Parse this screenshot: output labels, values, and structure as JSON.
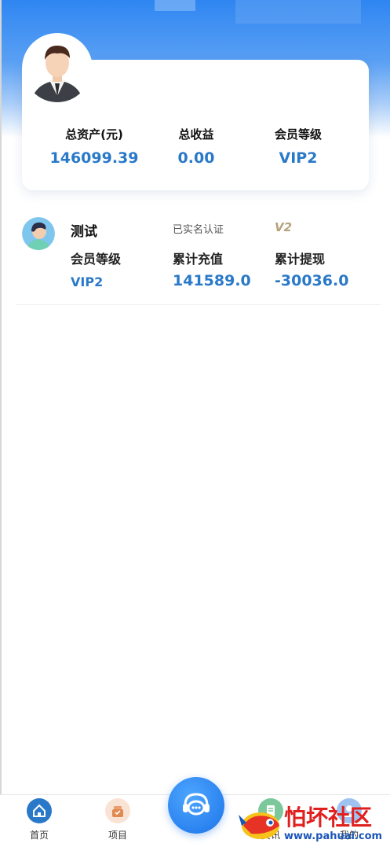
{
  "profile": {
    "avatar_icon": "male-avatar-icon",
    "stats": [
      {
        "label": "总资产(元)",
        "value": "146099.39"
      },
      {
        "label": "总收益",
        "value": "0.00"
      },
      {
        "label": "会员等级",
        "value": "VIP2"
      }
    ]
  },
  "user": {
    "avatar_icon": "user-avatar-icon",
    "name": "测试",
    "verified": "已实名认证",
    "vip_badge": "V2",
    "level_label": "会员等级",
    "level_value": "VIP2",
    "recharge_label": "累计充值",
    "recharge_value": "141589.0",
    "withdraw_label": "累计提现",
    "withdraw_value": "-30036.0"
  },
  "tabbar": {
    "items": [
      {
        "label": "首页",
        "icon": "home-icon"
      },
      {
        "label": "项目",
        "icon": "gift-icon"
      },
      {
        "label": "资讯",
        "icon": "news-icon"
      },
      {
        "label": "我的",
        "icon": "user-icon"
      }
    ],
    "service_icon": "customer-service-icon"
  },
  "watermark": {
    "title": "怕坏社区",
    "url": "www.pahuai.com"
  },
  "colors": {
    "accent": "#2a79c9",
    "header_blue": "#2f86f1",
    "service_blue": "#1b73e8"
  }
}
